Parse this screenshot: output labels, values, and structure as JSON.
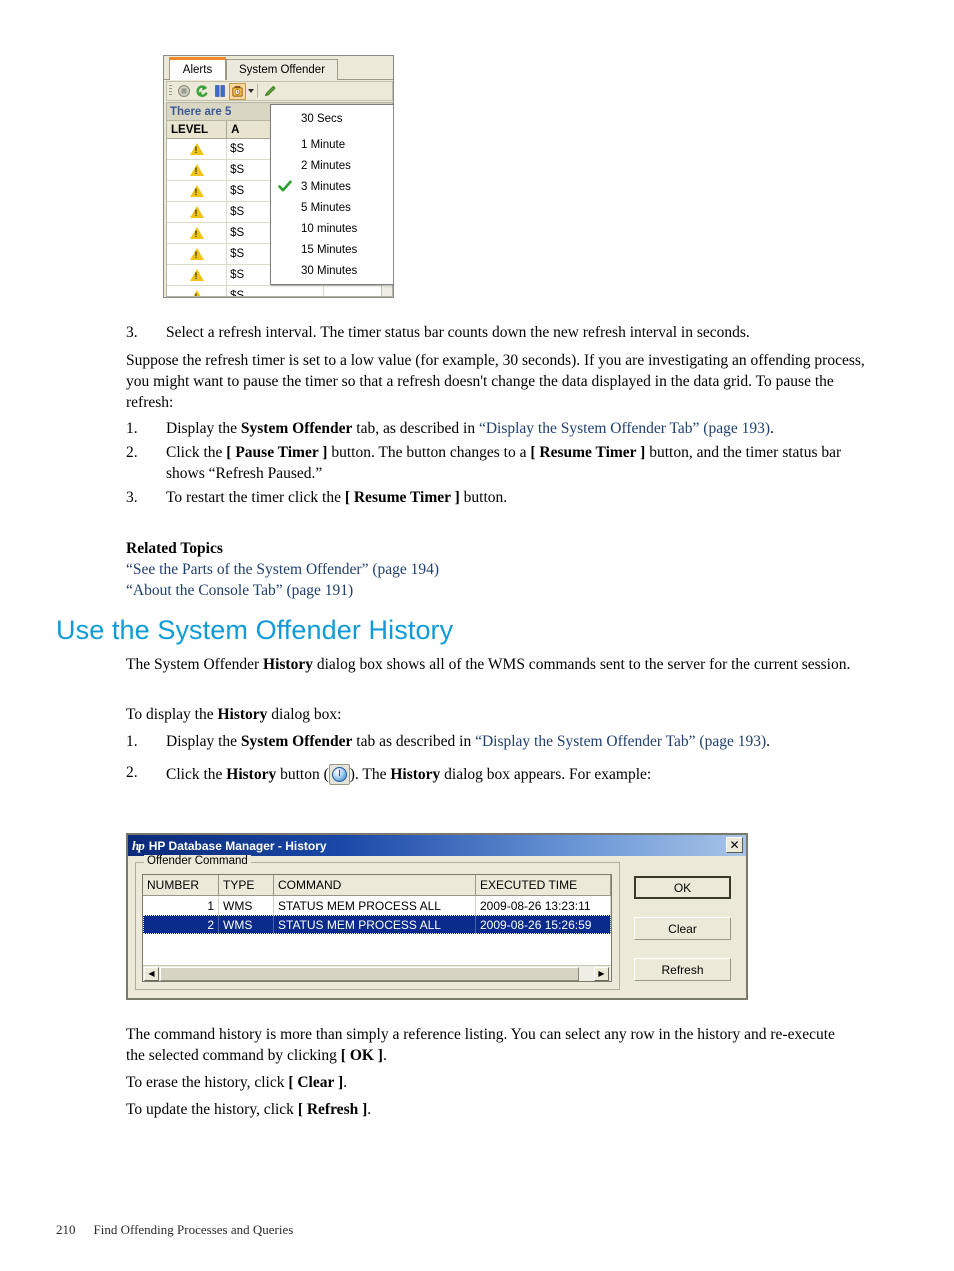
{
  "figure_alerts": {
    "name": "alerts-tab-screenshot",
    "tabs": [
      {
        "label": "Alerts",
        "active": true
      },
      {
        "label": "System Offender",
        "active": false
      }
    ],
    "toolbar": {
      "buttons": [
        {
          "icon": "stop-icon"
        },
        {
          "icon": "refresh-icon"
        },
        {
          "icon": "pause-timer-icon"
        },
        {
          "icon": "refresh-interval-icon",
          "pressed": true,
          "has_caret": true
        },
        {
          "icon": "edit-pencil-icon"
        }
      ]
    },
    "status_bar_text": "There are 5",
    "grid": {
      "headers": [
        "LEVEL",
        "A",
        ""
      ],
      "rows": [
        {
          "level": "warning-icon",
          "alert": "$S"
        },
        {
          "level": "warning-icon",
          "alert": "$S"
        },
        {
          "level": "warning-icon",
          "alert": "$S"
        },
        {
          "level": "warning-icon",
          "alert": "$S"
        },
        {
          "level": "warning-icon",
          "alert": "$S"
        },
        {
          "level": "warning-icon",
          "alert": "$S"
        },
        {
          "level": "warning-icon",
          "alert": "$S"
        },
        {
          "level": "warning-icon",
          "alert": "$S"
        }
      ]
    },
    "refresh_menu": {
      "items": [
        {
          "label": "30 Secs",
          "checked": false,
          "gap_after": true
        },
        {
          "label": "1 Minute",
          "checked": false
        },
        {
          "label": "2 Minutes",
          "checked": false
        },
        {
          "label": "3 Minutes",
          "checked": true
        },
        {
          "label": "5 Minutes",
          "checked": false
        },
        {
          "label": "10 minutes",
          "checked": false
        },
        {
          "label": "15 Minutes",
          "checked": false
        },
        {
          "label": "30 Minutes",
          "checked": false
        }
      ]
    }
  },
  "step3_top": {
    "number": "3.",
    "text": "Select a refresh interval. The timer status bar counts down the new refresh interval in seconds."
  },
  "paragraph_pause": "Suppose the refresh timer is set to a low value (for example, 30 seconds). If you are investigating an offending process, you might want to pause the timer so that a refresh doesn't change the data displayed in the data grid. To pause the refresh:",
  "pause_steps": [
    {
      "number": "1.",
      "pre": "Display the ",
      "bold1": "System Offender",
      "mid": " tab, as described in ",
      "link": "“Display the System Offender Tab” (page 193)",
      "post": "."
    },
    {
      "number": "2.",
      "pre": "Click the ",
      "bold1": "[ Pause Timer ]",
      "mid": " button. The button changes to a ",
      "bold2": "[ Resume Timer ]",
      "post": " button, and the timer status bar shows “Refresh Paused.”"
    },
    {
      "number": "3.",
      "pre": "To restart the timer click the ",
      "bold1": "[ Resume Timer ]",
      "post": " button."
    }
  ],
  "related_topics": {
    "heading": "Related Topics",
    "links": [
      "“See the Parts of the System Offender” (page 194)",
      "“About the Console Tab” (page 191)"
    ]
  },
  "section": {
    "heading": "Use the System Offender History",
    "intro_pre": "The System Offender ",
    "intro_bold": "History",
    "intro_post": " dialog box shows all of the WMS commands sent to the server for the current session.",
    "display_pre": "To display the ",
    "display_bold": "History",
    "display_post": " dialog box:",
    "steps": [
      {
        "number": "1.",
        "pre": "Display the ",
        "bold1": "System Offender",
        "mid": " tab as described in ",
        "link": "“Display the System Offender Tab” (page 193)",
        "post": "."
      },
      {
        "number": "2.",
        "pre": "Click the ",
        "bold1": "History",
        "mid": " button (",
        "icon": "history-clock-icon",
        "mid2": "). The ",
        "bold2": "History",
        "post": " dialog box appears. For example:"
      }
    ]
  },
  "figure_history": {
    "name": "history-dialog",
    "title": "HP Database Manager - History",
    "logo": "hp",
    "close_label": "✕",
    "groupbox_label": "Offender Command",
    "table": {
      "headers": [
        "NUMBER",
        "TYPE",
        "COMMAND",
        "EXECUTED TIME"
      ],
      "rows": [
        {
          "number": "1",
          "type": "WMS",
          "command": "STATUS MEM PROCESS ALL",
          "executed_time": "2009-08-26 13:23:11",
          "selected": false
        },
        {
          "number": "2",
          "type": "WMS",
          "command": "STATUS MEM PROCESS ALL",
          "executed_time": "2009-08-26 15:26:59",
          "selected": true
        }
      ]
    },
    "buttons": [
      {
        "label": "OK",
        "default": true
      },
      {
        "label": "Clear",
        "default": false
      },
      {
        "label": "Refresh",
        "default": false
      }
    ],
    "scroll_left_arrow": "◀",
    "scroll_right_arrow": "▶"
  },
  "closing": {
    "para1_pre": "The command history is more than simply a reference listing. You can select any row in the history and re-execute the selected command by clicking ",
    "para1_bold": "[ OK ]",
    "para1_post": ".",
    "para2_pre": "To erase the history, click ",
    "para2_bold": "[ Clear ]",
    "para2_post": ".",
    "para3_pre": "To update the history, click ",
    "para3_bold": "[ Refresh ]",
    "para3_post": "."
  },
  "footer": {
    "page_number": "210",
    "chapter": "Find Offending Processes and Queries"
  },
  "colors": {
    "heading": "#0e9bd8",
    "link": "#1f3f6e",
    "tab_active_accent": "#f08a24",
    "dialog_title": "#1b49a8",
    "row_selected": "#0a2a8c",
    "warning": "#f0c419"
  }
}
